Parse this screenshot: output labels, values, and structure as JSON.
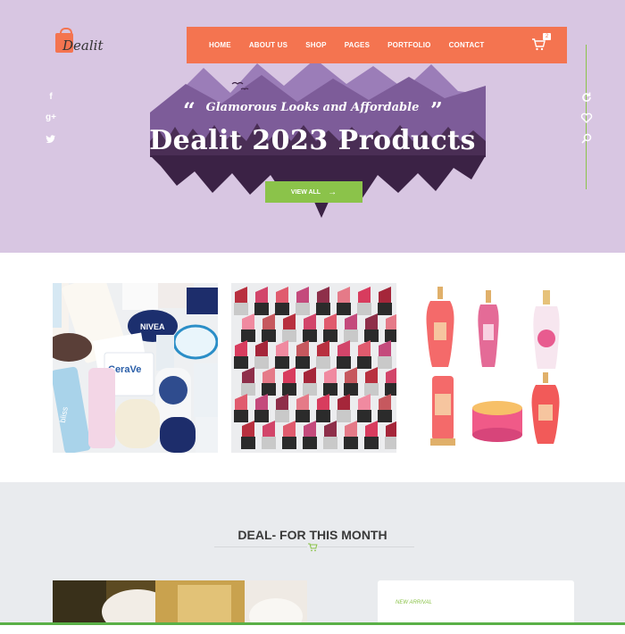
{
  "brand": {
    "logo_text": "Dealit",
    "accent": "#f47450",
    "green": "#8bc34a",
    "hero_bg": "#d8c6e2"
  },
  "nav": {
    "items": [
      "HOME",
      "ABOUT US",
      "SHOP",
      "PAGES",
      "PORTFOLIO",
      "CONTACT"
    ],
    "cart_count": "2",
    "cart_icon": "cart-icon"
  },
  "social": {
    "icons": [
      "facebook-icon",
      "google-plus-icon",
      "twitter-icon"
    ],
    "glyphs": [
      "f",
      "g+",
      "t"
    ]
  },
  "side_tools": {
    "icons": [
      "refresh-icon",
      "heart-icon",
      "search-icon"
    ]
  },
  "hero": {
    "subtitle": "Glamorous Looks and Affordable",
    "headline": "Dealit 2023 Products",
    "quote_open": "“",
    "quote_close": "”",
    "cta_label": "VIEW ALL",
    "cta_arrow": "→"
  },
  "products": {
    "images": [
      "skincare-products-image",
      "lipsticks-image",
      "body-mist-lotion-image"
    ]
  },
  "deal": {
    "title": "DEAL- FOR THIS MONTH",
    "card_tag": "NEW ARRIVAL"
  }
}
